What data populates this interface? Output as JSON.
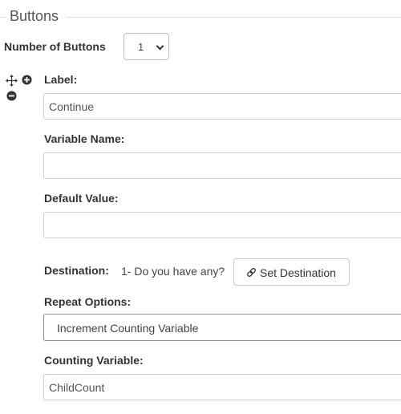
{
  "section": {
    "legend": "Buttons"
  },
  "num_buttons": {
    "label": "Number of Buttons",
    "selected": "1"
  },
  "button_item": {
    "icons": {
      "move": "move-arrows-icon",
      "add": "plus-circle-icon",
      "remove": "minus-circle-icon"
    },
    "label_field": {
      "label": "Label:",
      "value": "Continue"
    },
    "variable_name": {
      "label": "Variable Name:",
      "value": ""
    },
    "default_value": {
      "label": "Default Value:",
      "value": ""
    },
    "destination": {
      "label": "Destination:",
      "value": "1- Do you have any?",
      "button_label": "Set Destination",
      "button_icon": "link-icon"
    },
    "repeat_options": {
      "label": "Repeat Options:",
      "selected": "Increment Counting Variable"
    },
    "counting_variable": {
      "label": "Counting Variable:",
      "value": "ChildCount"
    }
  }
}
